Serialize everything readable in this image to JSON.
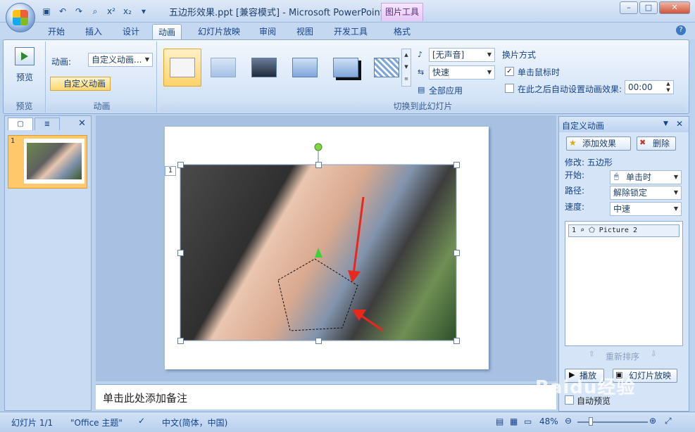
{
  "window": {
    "title": "五边形效果.ppt [兼容模式] - Microsoft PowerPoint",
    "contextual_tab": "图片工具",
    "qat_icons": [
      "save-icon",
      "undo-icon",
      "redo-icon",
      "preview-icon",
      "superscript-icon",
      "subscript-icon",
      "customize-icon"
    ],
    "qat_glyphs": [
      "▣",
      "↶",
      "↷",
      "⌕",
      "x²",
      "x₂",
      "▾"
    ],
    "controls": {
      "minimize": "–",
      "maximize": "□",
      "close": "✕"
    }
  },
  "tabs": [
    "开始",
    "插入",
    "设计",
    "动画",
    "幻灯片放映",
    "审阅",
    "视图",
    "开发工具",
    "格式"
  ],
  "active_tab": "动画",
  "ribbon": {
    "preview_group": {
      "button_label": "预览",
      "group_label": "预览"
    },
    "animation_group": {
      "anim_label": "动画:",
      "anim_value": "自定义动画...",
      "custom_button": "自定义动画",
      "group_label": "动画"
    },
    "transition_group": {
      "group_label": "切换到此幻灯片",
      "sound_value": "[无声音]",
      "speed_value": "快速",
      "apply_all": "全部应用",
      "switch_heading": "换片方式",
      "on_click_label": "单击鼠标时",
      "on_click_checked": "✓",
      "auto_label": "在此之后自动设置动画效果:",
      "auto_time": "00:00"
    }
  },
  "left_pane": {
    "slide_number": "1",
    "tab_close": "✕"
  },
  "slide": {
    "anim_marker": "1"
  },
  "notes_placeholder": "单击此处添加备注",
  "task_pane": {
    "title": "自定义动画",
    "add_effect": "添加效果",
    "remove": "删除",
    "modify_label": "修改: 五边形",
    "start_label": "开始:",
    "start_value": "单击时",
    "path_label": "路径:",
    "path_value": "解除锁定",
    "speed_label": "速度:",
    "speed_value": "中速",
    "list_item": "1 ⌕  ⬠  Picture 2",
    "reorder": "重新排序",
    "play": "播放",
    "slideshow": "幻灯片放映",
    "auto_preview": "自动预览"
  },
  "status": {
    "slide_info": "幻灯片 1/1",
    "theme": "\"Office 主题\"",
    "language": "中文(简体，中国)",
    "zoom": "48%"
  },
  "watermark": "Baidu经验"
}
